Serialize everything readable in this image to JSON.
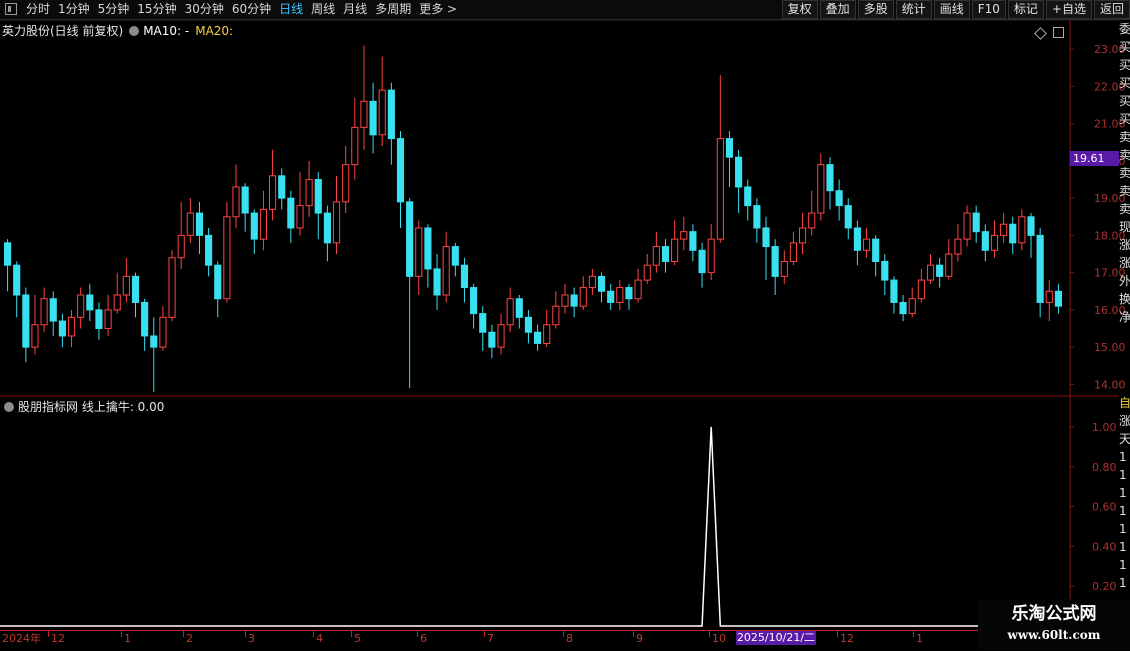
{
  "toolbar": {
    "periods": [
      {
        "label": "分时"
      },
      {
        "label": "1分钟"
      },
      {
        "label": "5分钟"
      },
      {
        "label": "15分钟"
      },
      {
        "label": "30分钟"
      },
      {
        "label": "60分钟"
      },
      {
        "label": "日线",
        "active": true
      },
      {
        "label": "周线"
      },
      {
        "label": "月线"
      },
      {
        "label": "多周期"
      },
      {
        "label": "更多 >"
      }
    ],
    "tools": [
      "复权",
      "叠加",
      "多股",
      "统计",
      "画线",
      "F10",
      "标记",
      "+自选",
      "返回"
    ]
  },
  "main_chart": {
    "title": "英力股份(日线 前复权)",
    "ma10_label": "MA10: -",
    "ma20_label": "MA20:",
    "current_price": "19.61"
  },
  "sub_chart": {
    "label": "股朋指标网 线上擒牛: 0.00"
  },
  "colors": {
    "up": "#ff4444",
    "down": "#38e0f0",
    "grid": "#8a1010",
    "price_tag": "#5a1aa8"
  },
  "side_panel_chars": [
    "委",
    "买",
    "买",
    "买",
    "买",
    "买",
    "卖",
    "卖",
    "卖",
    "卖",
    "卖",
    "现",
    "涨",
    "涨",
    "外",
    "换",
    "净"
  ],
  "side_panel_sub_chars": [
    "自",
    "涨",
    "天",
    "1",
    "1",
    "1",
    "1",
    "1",
    "1",
    "1",
    "1"
  ],
  "date_axis": {
    "labels": [
      "2024年",
      "12",
      "1",
      "2",
      "3",
      "4",
      "5",
      "6",
      "7",
      "8",
      "9",
      "10",
      "12",
      "1"
    ],
    "highlight": "2025/10/21/二"
  },
  "watermark": {
    "line1": "乐淘公式网",
    "line2": "www.60lt.com"
  },
  "chart_data": [
    {
      "type": "candlestick",
      "title": "英力股份(日线 前复权)",
      "ylim": [
        13.5,
        23.3
      ],
      "y_ticks": [
        "14.00",
        "15.00",
        "16.00",
        "17.00",
        "18.00",
        "19.00",
        "20.00",
        "21.00",
        "22.00",
        "23.00"
      ],
      "series": [
        {
          "name": "价格",
          "values": [
            [
              17.8,
              17.2,
              17.9,
              16.5
            ],
            [
              17.2,
              16.4,
              17.3,
              15.8
            ],
            [
              16.4,
              15.0,
              16.6,
              14.6
            ],
            [
              15.0,
              15.6,
              16.4,
              14.8
            ],
            [
              15.6,
              16.3,
              16.6,
              15.4
            ],
            [
              16.3,
              15.7,
              16.5,
              15.3
            ],
            [
              15.7,
              15.3,
              15.9,
              15.0
            ],
            [
              15.3,
              15.8,
              16.0,
              15.0
            ],
            [
              15.8,
              16.4,
              16.6,
              15.5
            ],
            [
              16.4,
              16.0,
              16.7,
              15.7
            ],
            [
              16.0,
              15.5,
              16.2,
              15.2
            ],
            [
              15.5,
              16.0,
              16.4,
              15.3
            ],
            [
              16.0,
              16.4,
              17.0,
              15.9
            ],
            [
              16.4,
              16.9,
              17.4,
              16.2
            ],
            [
              16.9,
              16.2,
              17.0,
              15.8
            ],
            [
              16.2,
              15.3,
              16.3,
              14.9
            ],
            [
              15.3,
              15.0,
              15.8,
              13.8
            ],
            [
              15.0,
              15.8,
              16.1,
              14.9
            ],
            [
              15.8,
              17.4,
              17.6,
              15.7
            ],
            [
              17.4,
              18.0,
              18.9,
              17.1
            ],
            [
              18.0,
              18.6,
              19.0,
              17.8
            ],
            [
              18.6,
              18.0,
              18.9,
              17.5
            ],
            [
              18.0,
              17.2,
              18.2,
              16.9
            ],
            [
              17.2,
              16.3,
              17.3,
              15.8
            ],
            [
              16.3,
              18.5,
              18.9,
              16.2
            ],
            [
              18.5,
              19.3,
              19.9,
              18.2
            ],
            [
              19.3,
              18.6,
              19.4,
              18.1
            ],
            [
              18.6,
              17.9,
              18.7,
              17.5
            ],
            [
              17.9,
              18.7,
              19.2,
              17.6
            ],
            [
              18.7,
              19.6,
              20.3,
              18.4
            ],
            [
              19.6,
              19.0,
              19.8,
              18.7
            ],
            [
              19.0,
              18.2,
              19.2,
              17.8
            ],
            [
              18.2,
              18.8,
              19.7,
              18.0
            ],
            [
              18.8,
              19.5,
              20.0,
              18.5
            ],
            [
              19.5,
              18.6,
              19.7,
              17.9
            ],
            [
              18.6,
              17.8,
              18.8,
              17.3
            ],
            [
              17.8,
              18.9,
              19.6,
              17.5
            ],
            [
              18.9,
              19.9,
              20.4,
              18.6
            ],
            [
              19.9,
              20.9,
              21.7,
              19.5
            ],
            [
              20.9,
              21.6,
              23.1,
              20.3
            ],
            [
              21.6,
              20.7,
              22.1,
              20.2
            ],
            [
              20.7,
              21.9,
              22.8,
              20.4
            ],
            [
              21.9,
              20.6,
              22.1,
              19.9
            ],
            [
              20.6,
              18.9,
              20.8,
              18.2
            ],
            [
              18.9,
              16.9,
              19.0,
              13.9
            ],
            [
              16.9,
              18.2,
              18.4,
              16.4
            ],
            [
              18.2,
              17.1,
              18.3,
              16.6
            ],
            [
              17.1,
              16.4,
              17.5,
              16.0
            ],
            [
              16.4,
              17.7,
              18.1,
              16.2
            ],
            [
              17.7,
              17.2,
              17.8,
              16.9
            ],
            [
              17.2,
              16.6,
              17.4,
              16.2
            ],
            [
              16.6,
              15.9,
              16.7,
              15.5
            ],
            [
              15.9,
              15.4,
              16.1,
              14.9
            ],
            [
              15.4,
              15.0,
              15.6,
              14.7
            ],
            [
              15.0,
              15.6,
              15.9,
              14.8
            ],
            [
              15.6,
              16.3,
              16.6,
              15.4
            ],
            [
              16.3,
              15.8,
              16.4,
              15.5
            ],
            [
              15.8,
              15.4,
              16.0,
              15.1
            ],
            [
              15.4,
              15.1,
              15.6,
              14.9
            ],
            [
              15.1,
              15.6,
              16.0,
              15.0
            ],
            [
              15.6,
              16.1,
              16.5,
              15.5
            ],
            [
              16.1,
              16.4,
              16.7,
              15.9
            ],
            [
              16.4,
              16.1,
              16.6,
              15.8
            ],
            [
              16.1,
              16.6,
              16.9,
              16.0
            ],
            [
              16.6,
              16.9,
              17.1,
              16.4
            ],
            [
              16.9,
              16.5,
              17.0,
              16.2
            ],
            [
              16.5,
              16.2,
              16.7,
              16.0
            ],
            [
              16.2,
              16.6,
              16.8,
              16.0
            ],
            [
              16.6,
              16.3,
              16.7,
              16.0
            ],
            [
              16.3,
              16.8,
              17.1,
              16.2
            ],
            [
              16.8,
              17.2,
              17.5,
              16.7
            ],
            [
              17.2,
              17.7,
              18.1,
              17.0
            ],
            [
              17.7,
              17.3,
              17.9,
              17.0
            ],
            [
              17.3,
              17.9,
              18.4,
              17.2
            ],
            [
              17.9,
              18.1,
              18.5,
              17.6
            ],
            [
              18.1,
              17.6,
              18.3,
              17.3
            ],
            [
              17.6,
              17.0,
              17.8,
              16.6
            ],
            [
              17.0,
              17.9,
              18.3,
              16.8
            ],
            [
              17.9,
              20.6,
              22.3,
              17.8
            ],
            [
              20.6,
              20.1,
              20.8,
              19.3
            ],
            [
              20.1,
              19.3,
              20.3,
              18.6
            ],
            [
              19.3,
              18.8,
              19.5,
              18.4
            ],
            [
              18.8,
              18.2,
              19.0,
              17.8
            ],
            [
              18.2,
              17.7,
              18.5,
              16.8
            ],
            [
              17.7,
              16.9,
              17.9,
              16.4
            ],
            [
              16.9,
              17.3,
              17.6,
              16.7
            ],
            [
              17.3,
              17.8,
              18.1,
              17.2
            ],
            [
              17.8,
              18.2,
              18.6,
              17.5
            ],
            [
              18.2,
              18.6,
              19.2,
              18.0
            ],
            [
              18.6,
              19.9,
              20.2,
              18.4
            ],
            [
              19.9,
              19.2,
              20.1,
              18.7
            ],
            [
              19.2,
              18.8,
              19.5,
              18.4
            ],
            [
              18.8,
              18.2,
              19.0,
              17.9
            ],
            [
              18.2,
              17.6,
              18.4,
              17.2
            ],
            [
              17.6,
              17.9,
              18.2,
              17.4
            ],
            [
              17.9,
              17.3,
              18.0,
              16.9
            ],
            [
              17.3,
              16.8,
              17.5,
              16.4
            ],
            [
              16.8,
              16.2,
              16.9,
              15.9
            ],
            [
              16.2,
              15.9,
              16.4,
              15.7
            ],
            [
              15.9,
              16.3,
              16.6,
              15.8
            ],
            [
              16.3,
              16.8,
              17.1,
              16.2
            ],
            [
              16.8,
              17.2,
              17.5,
              16.7
            ],
            [
              17.2,
              16.9,
              17.4,
              16.6
            ],
            [
              16.9,
              17.5,
              17.9,
              16.8
            ],
            [
              17.5,
              17.9,
              18.3,
              17.3
            ],
            [
              17.9,
              18.6,
              18.8,
              17.7
            ],
            [
              18.6,
              18.1,
              18.8,
              17.8
            ],
            [
              18.1,
              17.6,
              18.3,
              17.3
            ],
            [
              17.6,
              18.0,
              18.4,
              17.4
            ],
            [
              18.0,
              18.3,
              18.6,
              17.8
            ],
            [
              18.3,
              17.8,
              18.5,
              17.5
            ],
            [
              17.8,
              18.5,
              18.7,
              17.6
            ],
            [
              18.5,
              18.0,
              18.6,
              17.4
            ],
            [
              18.0,
              16.2,
              18.2,
              15.8
            ],
            [
              16.2,
              16.5,
              16.8,
              15.7
            ],
            [
              16.5,
              16.1,
              16.7,
              15.9
            ]
          ]
        }
      ]
    },
    {
      "type": "line",
      "title": "股朋指标网 线上擒牛",
      "ylim": [
        0,
        1.05
      ],
      "y_ticks": [
        "0.20",
        "0.40",
        "0.60",
        "0.80",
        "1.00"
      ],
      "series": [
        {
          "name": "线上擒牛",
          "values": [
            0,
            0,
            0,
            0,
            0,
            0,
            0,
            0,
            0,
            0,
            0,
            0,
            0,
            0,
            0,
            0,
            0,
            0,
            0,
            0,
            0,
            0,
            0,
            0,
            0,
            0,
            0,
            0,
            0,
            0,
            0,
            0,
            0,
            0,
            0,
            0,
            0,
            0,
            0,
            0,
            0,
            0,
            0,
            0,
            0,
            0,
            0,
            0,
            0,
            0,
            0,
            0,
            0,
            0,
            0,
            0,
            0,
            0,
            0,
            0,
            0,
            0,
            0,
            0,
            0,
            0,
            0,
            0,
            0,
            0,
            0,
            0,
            0,
            0,
            0,
            0,
            0,
            1,
            0,
            0,
            0,
            0,
            0,
            0,
            0,
            0,
            0,
            0,
            0,
            0,
            0,
            0,
            0,
            0,
            0,
            0,
            0,
            0,
            0,
            0,
            0,
            0,
            0,
            0,
            0,
            0,
            0,
            0,
            0,
            0,
            0,
            0,
            0,
            0,
            0,
            0
          ]
        }
      ]
    }
  ]
}
